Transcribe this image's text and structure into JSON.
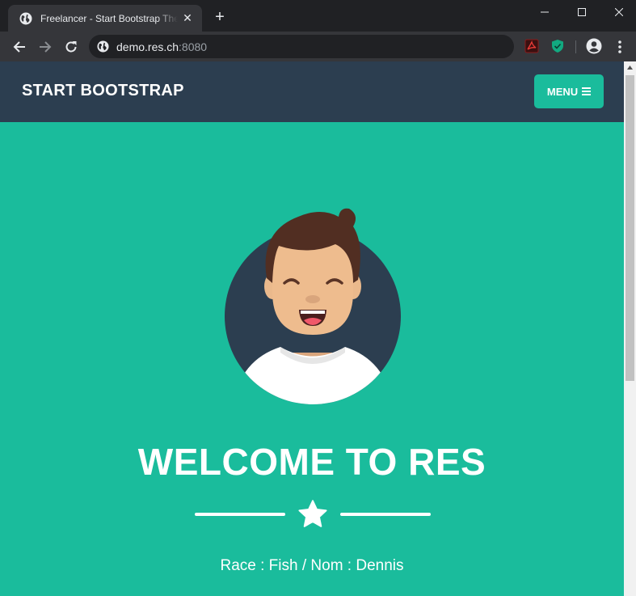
{
  "browser": {
    "tab_title": "Freelancer - Start Bootstrap Theme",
    "tab_close": "✕",
    "new_tab": "+",
    "url_host": "demo.res.ch",
    "url_port": ":8080",
    "icons": {
      "tab": "globe-icon",
      "omnibox": "globe-icon",
      "back": "arrow-left-icon",
      "forward": "arrow-right-icon",
      "reload": "reload-icon",
      "extension_1": "pdf-extension-icon",
      "extension_2": "shield-extension-icon",
      "profile": "profile-icon",
      "menu": "kebab-menu-icon"
    }
  },
  "navbar": {
    "brand": "START BOOTSTRAP",
    "menu_label": "MENU"
  },
  "masthead": {
    "heading": "WELCOME TO RES",
    "subheading": "Race : Fish / Nom : Dennis"
  },
  "colors": {
    "primary": "#1abc9c",
    "secondary": "#2c3e50",
    "text": "#ffffff"
  }
}
